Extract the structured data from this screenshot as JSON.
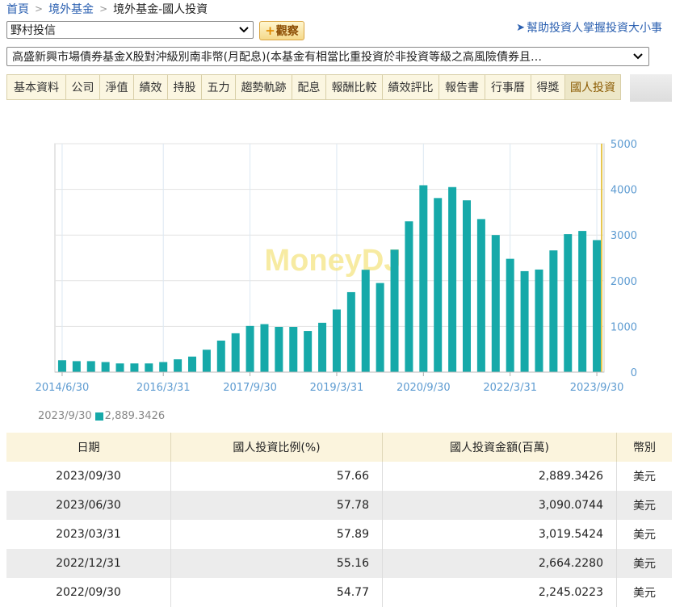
{
  "breadcrumb": {
    "home": "首頁",
    "section": "境外基金",
    "current": "境外基金-國人投資"
  },
  "company_select": {
    "value": "野村投信"
  },
  "watch_button": {
    "label": "觀察"
  },
  "help_link": {
    "label": "幫助投資人掌握投資大小事"
  },
  "fund_select": {
    "value": "高盛新興市場債券基金X股對沖級別南非幣(月配息)(本基金有相當比重投資於非投資等級之高風險債券且…"
  },
  "tabs": [
    "基本資料",
    "公司",
    "淨值",
    "績效",
    "持股",
    "五力",
    "趨勢軌跡",
    "配息",
    "報酬比較",
    "績效評比",
    "報告書",
    "行事曆",
    "得獎",
    "國人投資"
  ],
  "active_tab": "國人投資",
  "chart_data": {
    "type": "bar",
    "watermark": "MoneyDJ",
    "color": "#16a9a9",
    "highlight_color": "#e6c64a",
    "categories": [
      "2014/6/30",
      "2014/9/30",
      "2014/12/31",
      "2015/3/31",
      "2015/6/30",
      "2015/9/30",
      "2015/12/31",
      "2016/3/31",
      "2016/6/30",
      "2016/9/30",
      "2016/12/31",
      "2017/3/31",
      "2017/6/30",
      "2017/9/30",
      "2017/12/31",
      "2018/3/31",
      "2018/6/30",
      "2018/9/30",
      "2018/12/31",
      "2019/3/31",
      "2019/6/30",
      "2019/9/30",
      "2019/12/31",
      "2020/3/31",
      "2020/6/30",
      "2020/9/30",
      "2020/12/31",
      "2021/3/31",
      "2021/6/30",
      "2021/9/30",
      "2021/12/31",
      "2022/3/31",
      "2022/6/30",
      "2022/9/30",
      "2022/12/31",
      "2023/3/31",
      "2023/6/30",
      "2023/9/30"
    ],
    "values": [
      260,
      240,
      240,
      220,
      190,
      190,
      190,
      220,
      280,
      340,
      490,
      690,
      850,
      1010,
      1050,
      990,
      990,
      900,
      1080,
      1370,
      1750,
      2240,
      1950,
      2680,
      3300,
      4090,
      3810,
      4050,
      3760,
      3350,
      3000,
      2480,
      2210,
      2245.0223,
      2664.228,
      3019.5424,
      3090.0744,
      2889.3426
    ],
    "x_tick_labels": [
      "2014/6/30",
      "2016/3/31",
      "2017/9/30",
      "2019/3/31",
      "2020/9/30",
      "2022/3/31",
      "2023/9/30"
    ],
    "y_ticks": [
      "0",
      "1000",
      "2000",
      "3000",
      "4000",
      "5000"
    ],
    "ylim": [
      0,
      5000
    ],
    "y_axis_side": "right",
    "grid": true,
    "legend": {
      "date": "2023/9/30",
      "value": "2,889.3426"
    }
  },
  "table": {
    "headers": {
      "date": "日期",
      "pct": "國人投資比例(%)",
      "amount": "國人投資金額(百萬)",
      "currency": "幣別"
    },
    "rows": [
      {
        "date": "2023/09/30",
        "pct": "57.66",
        "amount": "2,889.3426",
        "currency": "美元"
      },
      {
        "date": "2023/06/30",
        "pct": "57.78",
        "amount": "3,090.0744",
        "currency": "美元"
      },
      {
        "date": "2023/03/31",
        "pct": "57.89",
        "amount": "3,019.5424",
        "currency": "美元"
      },
      {
        "date": "2022/12/31",
        "pct": "55.16",
        "amount": "2,664.2280",
        "currency": "美元"
      },
      {
        "date": "2022/09/30",
        "pct": "54.77",
        "amount": "2,245.0223",
        "currency": "美元"
      }
    ]
  }
}
